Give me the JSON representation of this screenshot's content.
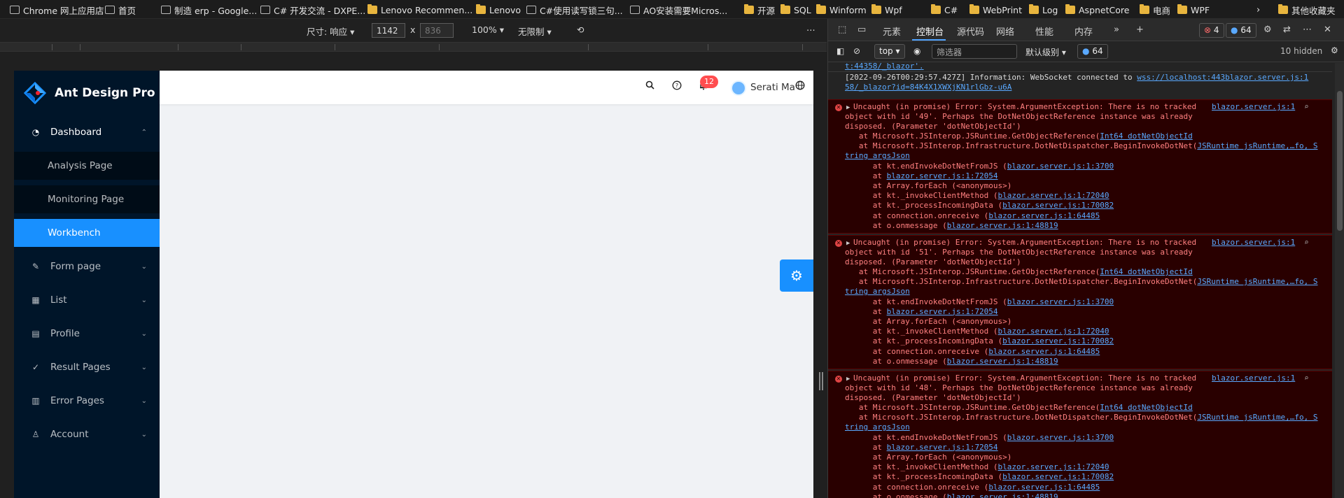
{
  "bookmarks": [
    {
      "label": "Chrome 网上应用店",
      "icon": "chrome-store-icon"
    },
    {
      "label": "首页",
      "icon": "home-icon"
    },
    {
      "label": "制造 erp - Google...",
      "icon": "doc-icon"
    },
    {
      "label": "C# 开发交流 - DXPE...",
      "icon": "page-icon"
    },
    {
      "label": "Lenovo Recommen...",
      "icon": "folder-icon"
    },
    {
      "label": "Lenovo",
      "icon": "folder-icon"
    },
    {
      "label": "C#使用读写锁三句...",
      "icon": "page-icon"
    },
    {
      "label": "AO安装需要Micros...",
      "icon": "page-icon"
    },
    {
      "label": "开源",
      "icon": "folder-icon"
    },
    {
      "label": "SQL",
      "icon": "folder-icon"
    },
    {
      "label": "Winform",
      "icon": "folder-icon"
    },
    {
      "label": "Wpf",
      "icon": "folder-icon"
    },
    {
      "label": "C#",
      "icon": "folder-icon"
    },
    {
      "label": "WebPrint",
      "icon": "folder-icon"
    },
    {
      "label": "Log",
      "icon": "folder-icon"
    },
    {
      "label": "AspnetCore",
      "icon": "folder-icon"
    },
    {
      "label": "电商",
      "icon": "folder-icon"
    },
    {
      "label": "WPF",
      "icon": "folder-icon"
    },
    {
      "label": "其他收藏夹",
      "icon": "folder-icon"
    }
  ],
  "device_toolbar": {
    "dimensions_label": "尺寸: 响应",
    "width_value": "1142",
    "times": "x",
    "height_placeholder": "836",
    "zoom": "100%",
    "throttle": "无限制"
  },
  "app": {
    "logo_title": "Ant Design Pro",
    "menu": [
      {
        "label": "Dashboard",
        "icon": "dashboard-icon",
        "expanded": true
      },
      {
        "label": "Analysis Page",
        "sub": true
      },
      {
        "label": "Monitoring Page",
        "sub": true
      },
      {
        "label": "Workbench",
        "sub": true,
        "selected": true
      },
      {
        "label": "Form page",
        "icon": "form-icon"
      },
      {
        "label": "List",
        "icon": "table-icon"
      },
      {
        "label": "Profile",
        "icon": "profile-icon"
      },
      {
        "label": "Result Pages",
        "icon": "check-circle-icon"
      },
      {
        "label": "Error Pages",
        "icon": "warning-icon"
      },
      {
        "label": "Account",
        "icon": "user-icon"
      }
    ],
    "header": {
      "notification_count": "12",
      "user_name": "Serati Ma"
    },
    "colors": {
      "sidebar": "#001529",
      "selected": "#1890ff",
      "badge": "#ff4d4f"
    }
  },
  "devtools": {
    "tabs": [
      "元素",
      "控制台",
      "源代码",
      "网络",
      "性能",
      "内存"
    ],
    "active_tab": "控制台",
    "error_count": "4",
    "message_count": "64",
    "context": "top",
    "filter_placeholder": "筛选器",
    "level": "默认级别",
    "level_count": "64",
    "hidden": "10 hidden",
    "log_top": "t:44358/_blazor'.",
    "info_line1": "[2022-09-26T00:29:57.427Z] Information: WebSocket connected to ",
    "info_link1": "wss://localhost:443",
    "info_src": "blazor.server.js:1",
    "info_line2": "58/_blazor?id=84K4X1XWXjKN1rlGbz-u6A",
    "errors": [
      {
        "head": "Uncaught (in promise) Error: System.ArgumentException: There is no tracked",
        "src": "blazor.server.js:1",
        "l2": "object with id '49'. Perhaps the DotNetObjectReference instance was already",
        "l3": "disposed. (Parameter 'dotNetObjectId')"
      },
      {
        "head": "Uncaught (in promise) Error: System.ArgumentException: There is no tracked",
        "src": "blazor.server.js:1",
        "l2": "object with id '51'. Perhaps the DotNetObjectReference instance was already",
        "l3": "disposed. (Parameter 'dotNetObjectId')"
      },
      {
        "head": "Uncaught (in promise) Error: System.ArgumentException: There is no tracked",
        "src": "blazor.server.js:1",
        "l2": "object with id '48'. Perhaps the DotNetObjectReference instance was already",
        "l3": "disposed. (Parameter 'dotNetObjectId')"
      }
    ],
    "stack": {
      "s1": "   at Microsoft.JSInterop.JSRuntime.GetObjectReference(",
      "s1_link": "Int64 dotNetObjectId",
      "s2": "   at Microsoft.JSInterop.Infrastructure.DotNetDispatcher.BeginInvokeDotNet(",
      "s2_link": "JSRuntime jsRuntime,…fo, S",
      "s3_link": "tring argsJson",
      "s4": "      at kt.endInvokeDotNetFromJS (",
      "s4_link": "blazor.server.js:1:3700",
      "s5": "      at ",
      "s5_link": "blazor.server.js:1:72054",
      "s6": "      at Array.forEach (<anonymous>)",
      "s7": "      at kt._invokeClientMethod (",
      "s7_link": "blazor.server.js:1:72040",
      "s8": "      at kt._processIncomingData (",
      "s8_link": "blazor.server.js:1:70082",
      "s9": "      at connection.onreceive (",
      "s9_link": "blazor.server.js:1:64485",
      "s10": "      at o.onmessage (",
      "s10_link": "blazor.server.js:1:48819"
    }
  }
}
